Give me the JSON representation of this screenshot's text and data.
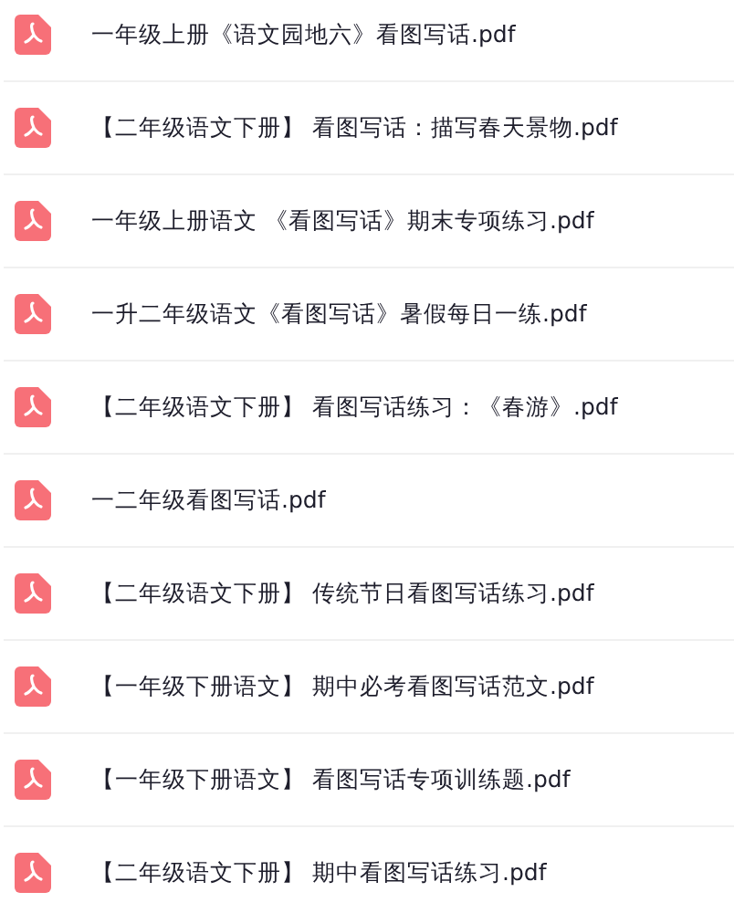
{
  "files": [
    {
      "name": "一年级上册《语文园地六》看图写话.pdf"
    },
    {
      "name": "【二年级语文下册】 看图写话：描写春天景物.pdf"
    },
    {
      "name": "一年级上册语文 《看图写话》期末专项练习.pdf"
    },
    {
      "name": "一升二年级语文《看图写话》暑假每日一练.pdf"
    },
    {
      "name": "【二年级语文下册】 看图写话练习：《春游》.pdf"
    },
    {
      "name": "一二年级看图写话.pdf"
    },
    {
      "name": "【二年级语文下册】 传统节日看图写话练习.pdf"
    },
    {
      "name": "【一年级下册语文】 期中必考看图写话范文.pdf"
    },
    {
      "name": "【一年级下册语文】 看图写话专项训练题.pdf"
    },
    {
      "name": "【二年级语文下册】 期中看图写话练习.pdf"
    }
  ]
}
